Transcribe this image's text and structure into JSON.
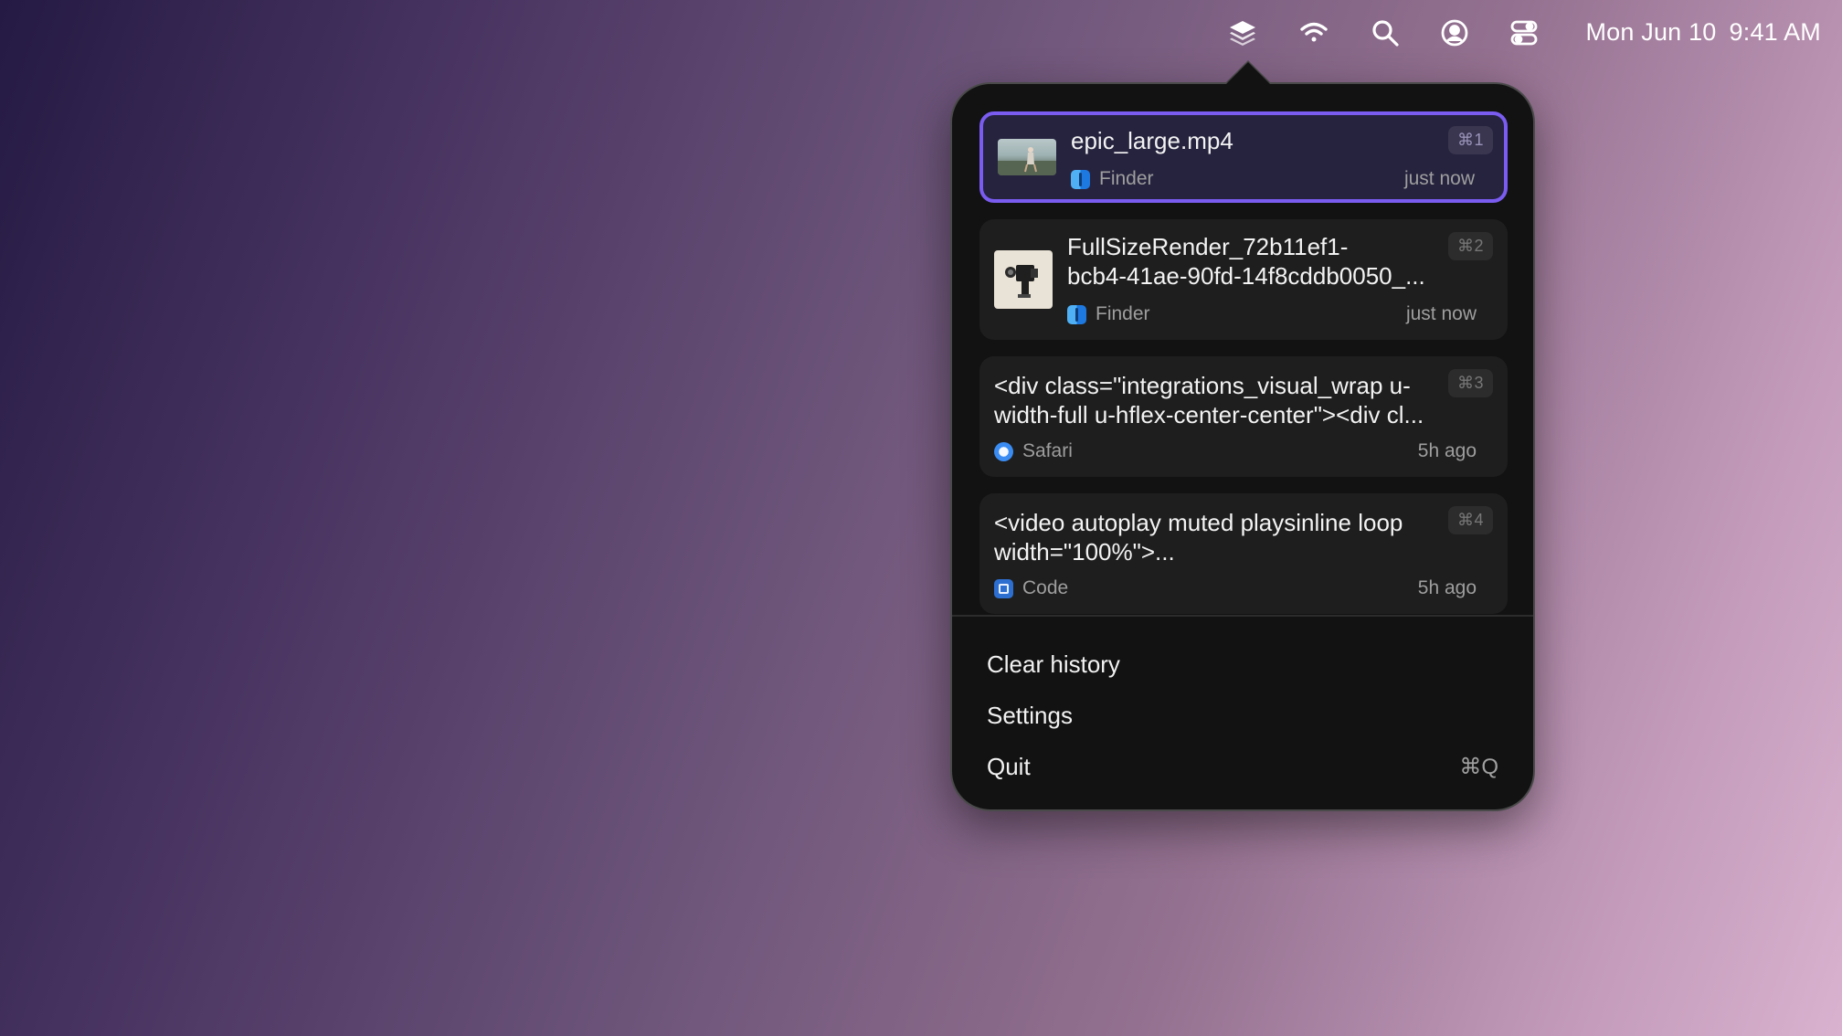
{
  "menubar": {
    "icons": [
      "stack-app-icon",
      "wifi-icon",
      "search-icon",
      "user-icon",
      "control-center-icon"
    ],
    "date": "Mon Jun 10",
    "time": "9:41 AM"
  },
  "clipboard_items": [
    {
      "title": "epic_large.mp4",
      "source": "Finder",
      "time": "just now",
      "shortcut": "⌘1",
      "selected": true
    },
    {
      "title": "FullSizeRender_72b11ef1-\nbcb4-41ae-90fd-14f8cddb0050_...",
      "source": "Finder",
      "time": "just now",
      "shortcut": "⌘2",
      "selected": false
    },
    {
      "title": "<div class=\"integrations_visual_wrap u-\nwidth-full u-hflex-center-center\"><div cl...",
      "source": "Safari",
      "time": "5h ago",
      "shortcut": "⌘3",
      "selected": false
    },
    {
      "title": "<video autoplay muted playsinline loop\nwidth=\"100%\">...",
      "source": "Code",
      "time": "5h ago",
      "shortcut": "⌘4",
      "selected": false
    }
  ],
  "menu": {
    "clear_history": "Clear history",
    "settings": "Settings",
    "quit": "Quit",
    "quit_shortcut": "⌘Q"
  },
  "colors": {
    "accent": "#7a5cf0",
    "popover_bg": "#121212",
    "item_bg": "#1e1e1e"
  }
}
